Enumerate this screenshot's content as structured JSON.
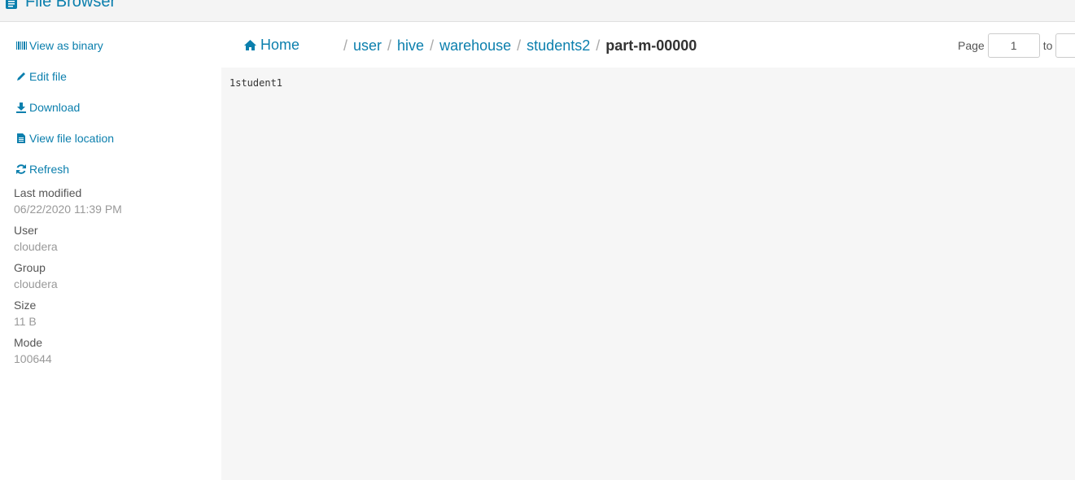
{
  "app": {
    "title": "File Browser"
  },
  "sidebar": {
    "actions": [
      {
        "label": "View as binary",
        "icon": "binary-icon"
      },
      {
        "label": "Edit file",
        "icon": "pencil-icon"
      },
      {
        "label": "Download",
        "icon": "download-icon"
      },
      {
        "label": "View file location",
        "icon": "file-icon"
      },
      {
        "label": "Refresh",
        "icon": "refresh-icon"
      }
    ],
    "properties": [
      {
        "label": "Last modified",
        "value": "06/22/2020 11:39 PM"
      },
      {
        "label": "User",
        "value": "cloudera"
      },
      {
        "label": "Group",
        "value": "cloudera"
      },
      {
        "label": "Size",
        "value": "11 B"
      },
      {
        "label": "Mode",
        "value": "100644"
      }
    ]
  },
  "breadcrumb": {
    "home": "Home",
    "separator": "/",
    "segments": [
      "user",
      "hive",
      "warehouse",
      "students2"
    ],
    "current": "part-m-00000"
  },
  "pager": {
    "page_label": "Page",
    "page_value": "1",
    "to_label": "to"
  },
  "file": {
    "content": "1student1"
  },
  "colors": {
    "link": "#0b7fad",
    "viewer_bg": "#f6f6f6"
  }
}
